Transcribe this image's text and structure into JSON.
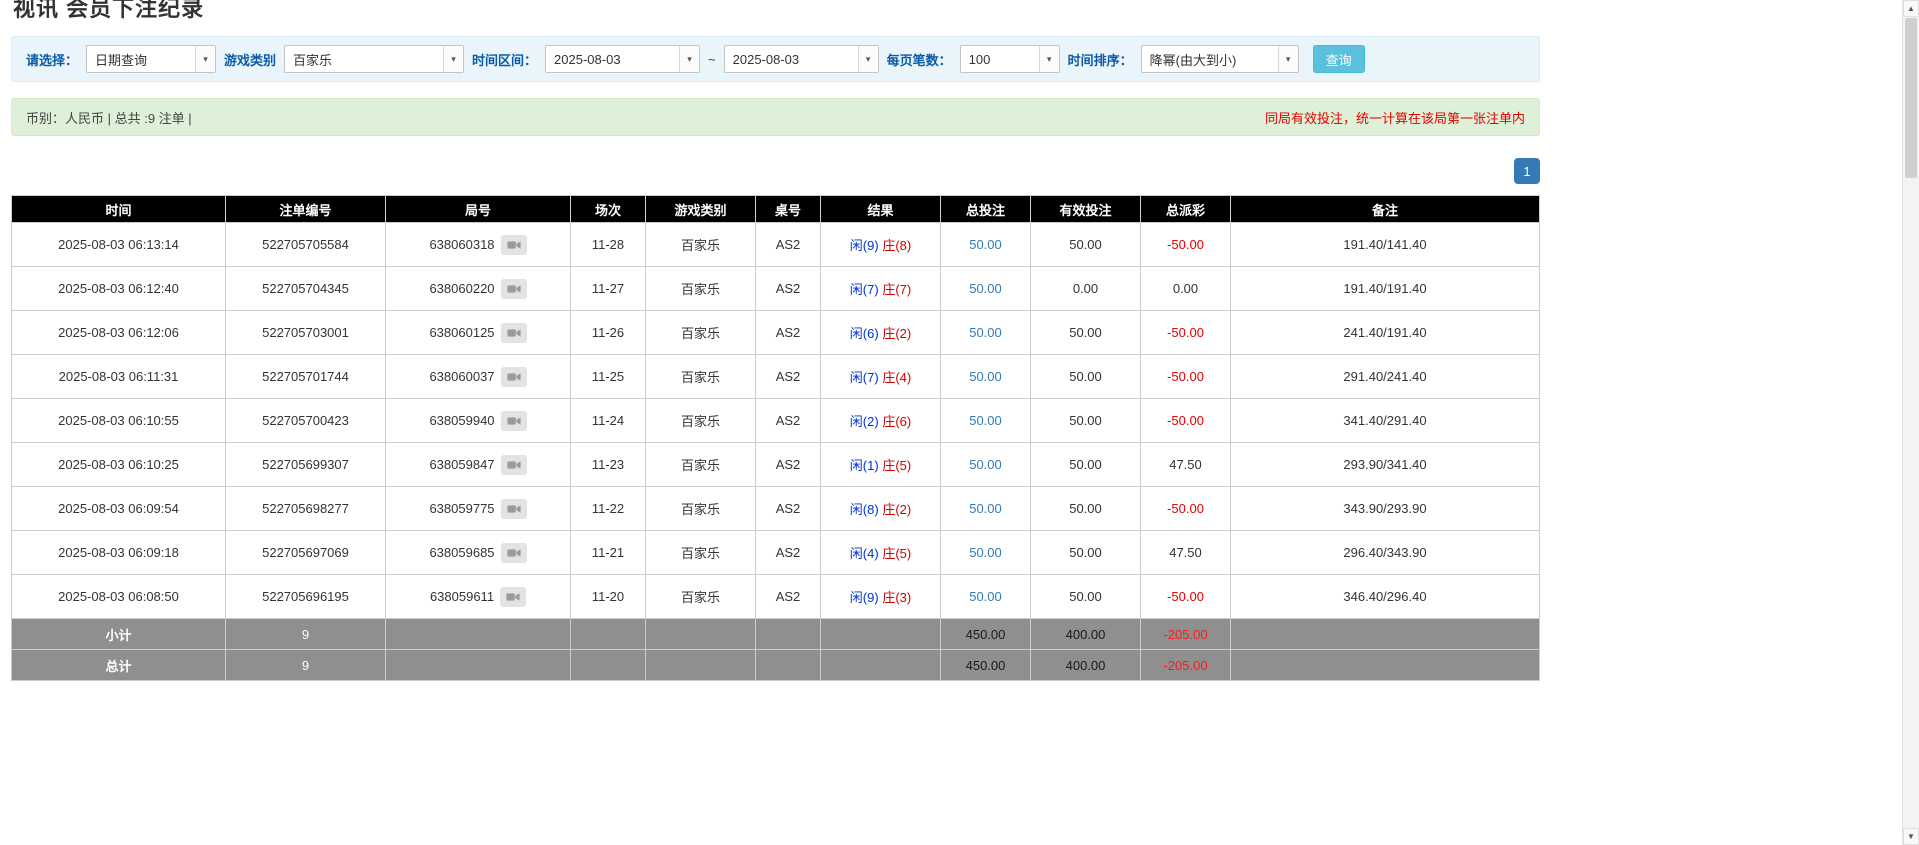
{
  "page": {
    "title": "视讯 会员下注纪录"
  },
  "colors": {
    "accent_blue": "#337ab7",
    "button_blue": "#5bc0de",
    "player_blue": "#0033cc",
    "banker_red": "#d40000",
    "negative_red": "#e60000",
    "summary_bg": "#dff0d8",
    "filter_bg": "#eaf4fb",
    "header_bg": "#000000",
    "footer_bg": "#8f8f8f"
  },
  "filters": {
    "select_label": "请选择：",
    "select_value": "日期查询",
    "game_type_label": "游戏类别",
    "game_type_value": "百家乐",
    "time_range_label": "时间区间：",
    "date_from": "2025-08-03",
    "tilde": "~",
    "date_to": "2025-08-03",
    "page_size_label": "每页笔数：",
    "page_size_value": "100",
    "sort_label": "时间排序：",
    "sort_value": "降幂(由大到小)",
    "search_button": "查询"
  },
  "summary": {
    "left": "币别：人民币 | 总共 :9 注单 |",
    "right": "同局有效投注，统一计算在该局第一张注单内"
  },
  "pagination": {
    "page": "1"
  },
  "table": {
    "headers": [
      "时间",
      "注单编号",
      "局号",
      "场次",
      "游戏类别",
      "桌号",
      "结果",
      "总投注",
      "有效投注",
      "总派彩",
      "备注"
    ],
    "rows": [
      {
        "time": "2025-08-03 06:13:14",
        "bet_id": "522705705584",
        "round": "638060318",
        "session": "11-28",
        "game": "百家乐",
        "table_no": "AS2",
        "player": "闲(9)",
        "banker": "庄(8)",
        "total_bet": "50.00",
        "valid_bet": "50.00",
        "payout": "-50.00",
        "note": "191.40/141.40"
      },
      {
        "time": "2025-08-03 06:12:40",
        "bet_id": "522705704345",
        "round": "638060220",
        "session": "11-27",
        "game": "百家乐",
        "table_no": "AS2",
        "player": "闲(7)",
        "banker": "庄(7)",
        "total_bet": "50.00",
        "valid_bet": "0.00",
        "payout": "0.00",
        "note": "191.40/191.40"
      },
      {
        "time": "2025-08-03 06:12:06",
        "bet_id": "522705703001",
        "round": "638060125",
        "session": "11-26",
        "game": "百家乐",
        "table_no": "AS2",
        "player": "闲(6)",
        "banker": "庄(2)",
        "total_bet": "50.00",
        "valid_bet": "50.00",
        "payout": "-50.00",
        "note": "241.40/191.40"
      },
      {
        "time": "2025-08-03 06:11:31",
        "bet_id": "522705701744",
        "round": "638060037",
        "session": "11-25",
        "game": "百家乐",
        "table_no": "AS2",
        "player": "闲(7)",
        "banker": "庄(4)",
        "total_bet": "50.00",
        "valid_bet": "50.00",
        "payout": "-50.00",
        "note": "291.40/241.40"
      },
      {
        "time": "2025-08-03 06:10:55",
        "bet_id": "522705700423",
        "round": "638059940",
        "session": "11-24",
        "game": "百家乐",
        "table_no": "AS2",
        "player": "闲(2)",
        "banker": "庄(6)",
        "total_bet": "50.00",
        "valid_bet": "50.00",
        "payout": "-50.00",
        "note": "341.40/291.40"
      },
      {
        "time": "2025-08-03 06:10:25",
        "bet_id": "522705699307",
        "round": "638059847",
        "session": "11-23",
        "game": "百家乐",
        "table_no": "AS2",
        "player": "闲(1)",
        "banker": "庄(5)",
        "total_bet": "50.00",
        "valid_bet": "50.00",
        "payout": "47.50",
        "note": "293.90/341.40"
      },
      {
        "time": "2025-08-03 06:09:54",
        "bet_id": "522705698277",
        "round": "638059775",
        "session": "11-22",
        "game": "百家乐",
        "table_no": "AS2",
        "player": "闲(8)",
        "banker": "庄(2)",
        "total_bet": "50.00",
        "valid_bet": "50.00",
        "payout": "-50.00",
        "note": "343.90/293.90"
      },
      {
        "time": "2025-08-03 06:09:18",
        "bet_id": "522705697069",
        "round": "638059685",
        "session": "11-21",
        "game": "百家乐",
        "table_no": "AS2",
        "player": "闲(4)",
        "banker": "庄(5)",
        "total_bet": "50.00",
        "valid_bet": "50.00",
        "payout": "47.50",
        "note": "296.40/343.90"
      },
      {
        "time": "2025-08-03 06:08:50",
        "bet_id": "522705696195",
        "round": "638059611",
        "session": "11-20",
        "game": "百家乐",
        "table_no": "AS2",
        "player": "闲(9)",
        "banker": "庄(3)",
        "total_bet": "50.00",
        "valid_bet": "50.00",
        "payout": "-50.00",
        "note": "346.40/296.40"
      }
    ],
    "subtotal": {
      "label": "小计",
      "count": "9",
      "total_bet": "450.00",
      "valid_bet": "400.00",
      "payout": "-205.00"
    },
    "total": {
      "label": "总计",
      "count": "9",
      "total_bet": "450.00",
      "valid_bet": "400.00",
      "payout": "-205.00"
    }
  }
}
